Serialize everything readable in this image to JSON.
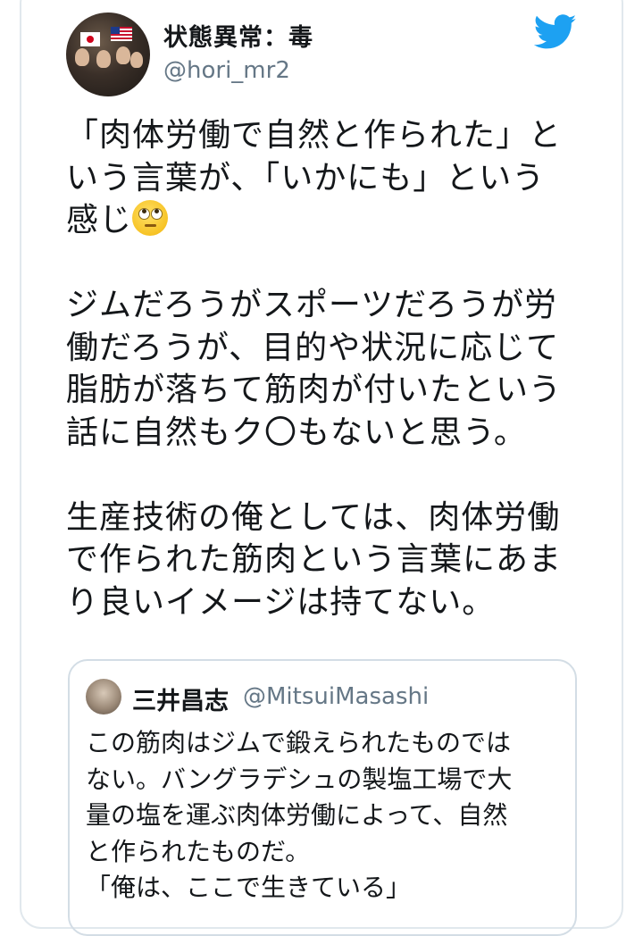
{
  "tweet": {
    "display_name": "状態異常：毒",
    "handle": "@hori_mr2",
    "paragraph1_before_emoji": "「肉体労働で自然と作られた」と\nいう言葉が、「いかにも」という\n感じ",
    "emoji_icon": "face-with-rolling-eyes",
    "paragraph2": "ジムだろうがスポーツだろうが労\n働だろうが、目的や状況に応じて\n脂肪が落ちて筋肉が付いたという\n話に自然もク〇もないと思う。",
    "paragraph3": "生産技術の俺としては、肉体労働\nで作られた筋肉という言葉にあま\nり良いイメージは持てない。"
  },
  "quoted_tweet": {
    "display_name": "三井昌志",
    "handle": "@MitsuiMasashi",
    "text": "この筋肉はジムで鍛えられたものでは\nない。バングラデシュの製塩工場で大\n量の塩を運ぶ肉体労働によって、自然\nと作られたものだ。\n「俺は、ここで生きている」"
  },
  "colors": {
    "brand_blue": "#1da1f2",
    "text": "#14171a",
    "secondary": "#657786",
    "border": "#e1e8ed"
  },
  "icons": [
    "twitter-bird-icon"
  ]
}
